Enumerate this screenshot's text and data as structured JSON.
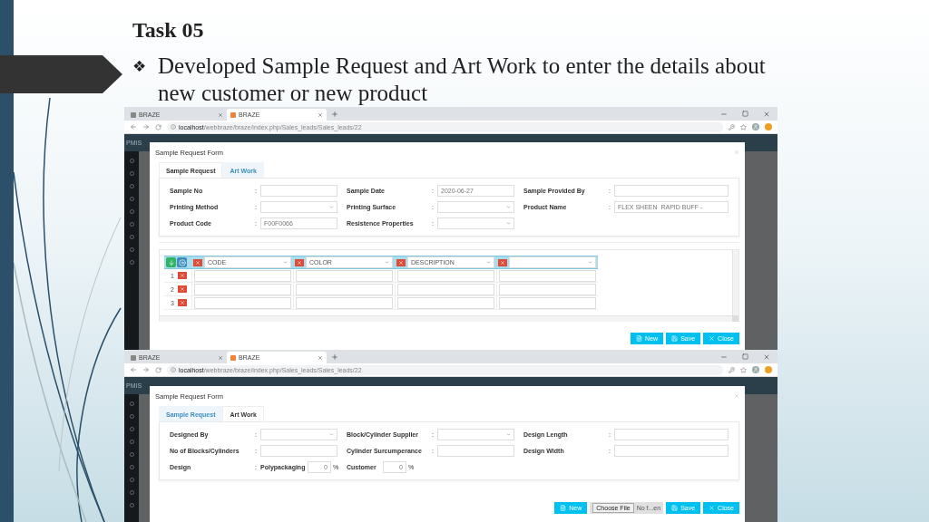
{
  "slide": {
    "title": "Task 05",
    "bullet": "❖",
    "text": "Developed Sample Request and Art Work to enter the details about new customer or new product"
  },
  "screenshots": [
    {
      "browser": {
        "tabs": [
          {
            "label": "BRAZE",
            "selected": false
          },
          {
            "label": "BRAZE",
            "selected": true
          }
        ],
        "url": "**localhost**/webbraze/braze/index.php/Sales_leads/Sales_leads/22"
      },
      "app": {
        "brand": "PMIS"
      },
      "modal": {
        "title": "Sample Request Form",
        "tabs": [
          {
            "label": "Sample Request",
            "selected": true
          },
          {
            "label": "Art Work",
            "selected": false
          }
        ],
        "form_rows": [
          [
            {
              "kind": "text",
              "label": "Sample No",
              "separator": ":"
            },
            {
              "kind": "text",
              "label": "Sample Date",
              "separator": ":",
              "value": "2020-06-27"
            },
            {
              "kind": "text",
              "label": "Sample Provided By",
              "separator": ":"
            }
          ],
          [
            {
              "kind": "select",
              "label": "Printing Method",
              "separator": ":"
            },
            {
              "kind": "select",
              "label": "Printing Surface",
              "separator": ":"
            },
            {
              "kind": "text",
              "label": "Product Name",
              "separator": ":",
              "value": "FLEX SHEEN  RAPID BUFF -"
            }
          ],
          [
            {
              "kind": "text",
              "label": "Product Code",
              "separator": ":",
              "value": "F00F0066"
            },
            {
              "kind": "select",
              "label": "Resistence Properties",
              "separator": ":"
            }
          ]
        ],
        "grid": {
          "columns": [
            {
              "kind": "select",
              "heading": "CODE"
            },
            {
              "kind": "select",
              "heading": "COLOR"
            },
            {
              "kind": "select",
              "heading": "DESCRIPTION"
            },
            {
              "kind": "select"
            }
          ],
          "rows": [
            {
              "number": "1"
            },
            {
              "number": "2"
            },
            {
              "number": "3"
            }
          ]
        },
        "buttons": [
          {
            "kind": "new",
            "label": "New"
          },
          {
            "kind": "save",
            "label": "Save"
          },
          {
            "kind": "close",
            "label": "Close"
          }
        ]
      }
    },
    {
      "browser": {
        "tabs": [
          {
            "label": "BRAZE",
            "selected": false
          },
          {
            "label": "BRAZE",
            "selected": true
          }
        ],
        "url": "**localhost**/webbraze/braze/index.php/Sales_leads/Sales_leads/22"
      },
      "app": {
        "brand": "PMIS"
      },
      "modal": {
        "title": "Sample Request Form",
        "tabs": [
          {
            "label": "Sample Request",
            "selected": false
          },
          {
            "label": "Art Work",
            "selected": true
          }
        ],
        "form_rows": [
          [
            {
              "kind": "select",
              "label": "Designed By",
              "separator": ":"
            },
            {
              "kind": "select",
              "label": "Block/Cylinder Supplier",
              "separator": ":"
            },
            {
              "kind": "text",
              "label": "Design Length",
              "separator": ":"
            }
          ],
          [
            {
              "kind": "text",
              "label": "No of Blocks/Cylinders",
              "separator": ":"
            },
            {
              "kind": "text",
              "label": "Cylinder Surcumperance",
              "separator": ":"
            },
            {
              "kind": "text",
              "label": "Design Width",
              "separator": ":"
            }
          ],
          [
            {
              "kind": "percent",
              "label": "Design",
              "separator": ":",
              "sub_label": "Polypackaging",
              "value": "0",
              "unit": "%"
            },
            {
              "kind": "inline_percent",
              "label": "Customer",
              "value": "0",
              "unit": "%"
            }
          ]
        ],
        "buttons": [
          {
            "kind": "new",
            "label": "New"
          },
          {
            "kind": "file",
            "label": "Choose File",
            "value": "No f...en"
          },
          {
            "kind": "save",
            "label": "Save"
          },
          {
            "kind": "close",
            "label": "Close"
          }
        ]
      }
    }
  ]
}
